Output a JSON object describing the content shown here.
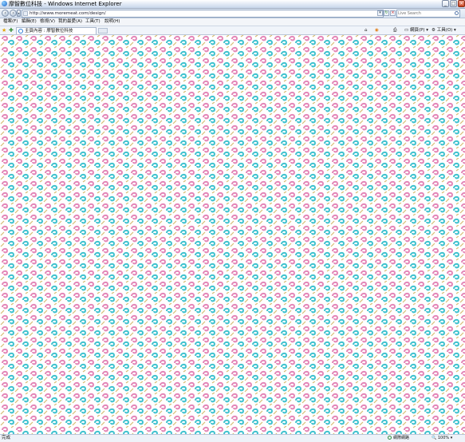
{
  "window": {
    "title": "摩智數位科技 - Windows Internet Explorer"
  },
  "address_bar": {
    "url": "http://www.moremeat.com/design/"
  },
  "search": {
    "placeholder": "Live Search"
  },
  "menu": [
    "檔案(F)",
    "編輯(E)",
    "檢視(V)",
    "我的最愛(A)",
    "工具(T)",
    "說明(H)"
  ],
  "tab": {
    "label": "主頁內容 : 摩智數位科技"
  },
  "commands": {
    "page": "網頁(P)",
    "tools": "工具(O)"
  },
  "statusbar": {
    "status": "完成",
    "zone": "網際網路",
    "zoom": "100%"
  },
  "pattern": {
    "colors": [
      "#e487b8",
      "#40c2cf",
      "#d7bc72"
    ]
  }
}
